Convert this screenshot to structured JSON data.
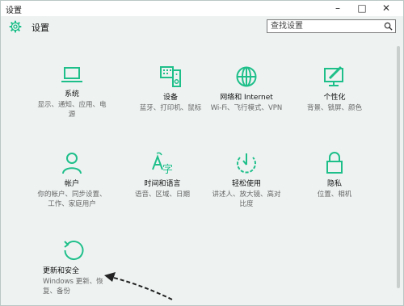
{
  "window": {
    "title": "设置"
  },
  "header": {
    "title": "设置"
  },
  "search": {
    "placeholder": "查找设置"
  },
  "tiles": [
    {
      "label": "系统",
      "desc_lines": [
        "显示、通知、应用、电",
        "源"
      ],
      "icon": "laptop-icon"
    },
    {
      "label": "设备",
      "desc_lines": [
        "蓝牙、打印机、鼠标"
      ],
      "icon": "devices-icon"
    },
    {
      "label": "网络和 Internet",
      "desc_lines": [
        "Wi-Fi、飞行模式、VPN"
      ],
      "icon": "globe-icon"
    },
    {
      "label": "个性化",
      "desc_lines": [
        "背景、锁屏、颜色"
      ],
      "icon": "personalization-icon"
    },
    {
      "label": "帐户",
      "desc_lines": [
        "你的帐户、同步设置、",
        "工作、家庭用户"
      ],
      "icon": "person-icon"
    },
    {
      "label": "时间和语言",
      "desc_lines": [
        "语音、区域、日期"
      ],
      "icon": "language-icon"
    },
    {
      "label": "轻松使用",
      "desc_lines": [
        "讲述人、放大镜、高对",
        "比度"
      ],
      "icon": "ease-of-access-icon"
    },
    {
      "label": "隐私",
      "desc_lines": [
        "位置、相机"
      ],
      "icon": "lock-icon"
    },
    {
      "label": "更新和安全",
      "desc_lines": [
        "Windows 更新、恢",
        "复、备份"
      ],
      "icon": "update-icon"
    }
  ],
  "colors": {
    "accent": "#1fbf8a",
    "teal": "#2a8f86"
  }
}
